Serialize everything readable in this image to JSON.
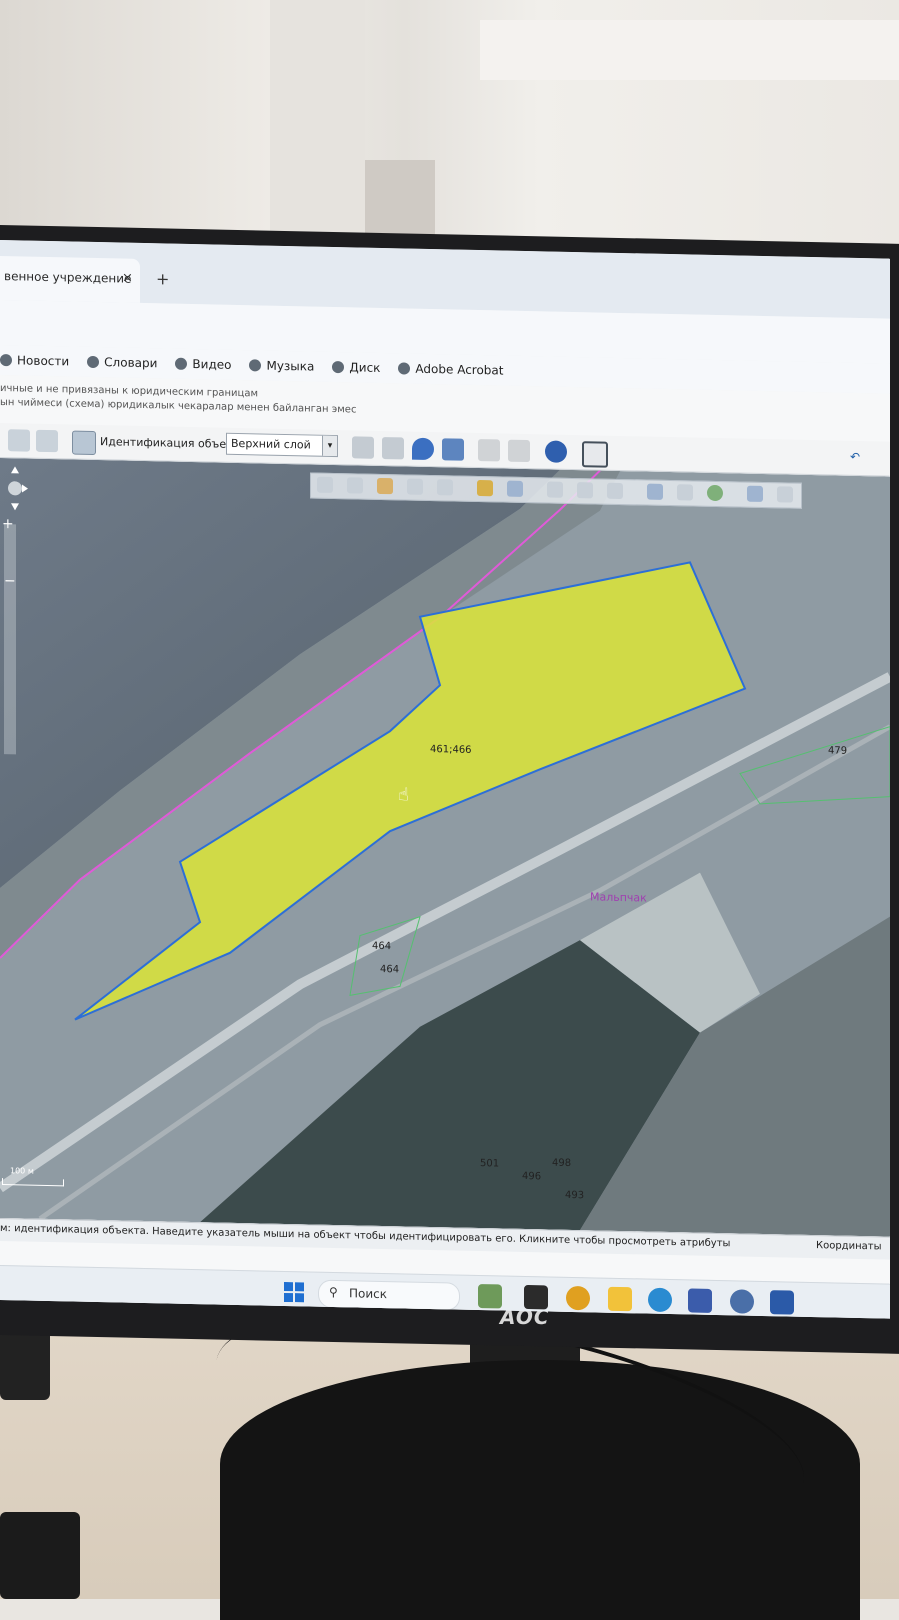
{
  "browser": {
    "tab_title": "венное учреждение",
    "tab_close": "×",
    "new_tab": "+",
    "bookmarks": [
      "Новости",
      "Словари",
      "Видео",
      "Музыка",
      "Диск",
      "Adobe Acrobat"
    ]
  },
  "page": {
    "disclaimer_ru": "ичные и не привязаны к юридическим границам",
    "disclaimer_kg": "ын чиймеси (схема) юридикалык чекаралар менен байланган эмес"
  },
  "toolbar": {
    "identify_label": "Идентификация объекта",
    "layer_select": "Верхний слой",
    "layer_arrow": "▾"
  },
  "map": {
    "labels": {
      "main_parcel": "461;466",
      "parcel_479": "479",
      "parcel_464a": "464",
      "parcel_464b": "464",
      "parcel_501": "501",
      "parcel_496": "496",
      "parcel_498": "498",
      "parcel_493": "493",
      "place_name": "Мальпчак"
    },
    "scale_label": "100 м",
    "colors": {
      "selected_parcel": "#d9e23a",
      "parcel_border": "#2d6fd6",
      "boundary_line": "#e05ad8"
    }
  },
  "status": {
    "text": "м: идентификация объекта. Наведите указатель мыши на объект чтобы идентифицировать его. Кликните чтобы просмотреть атрибуты",
    "coords": "Координаты"
  },
  "taskbar": {
    "search_glyph": "⚲",
    "search_placeholder": "Поиск"
  },
  "monitor": {
    "brand": "AOC"
  }
}
